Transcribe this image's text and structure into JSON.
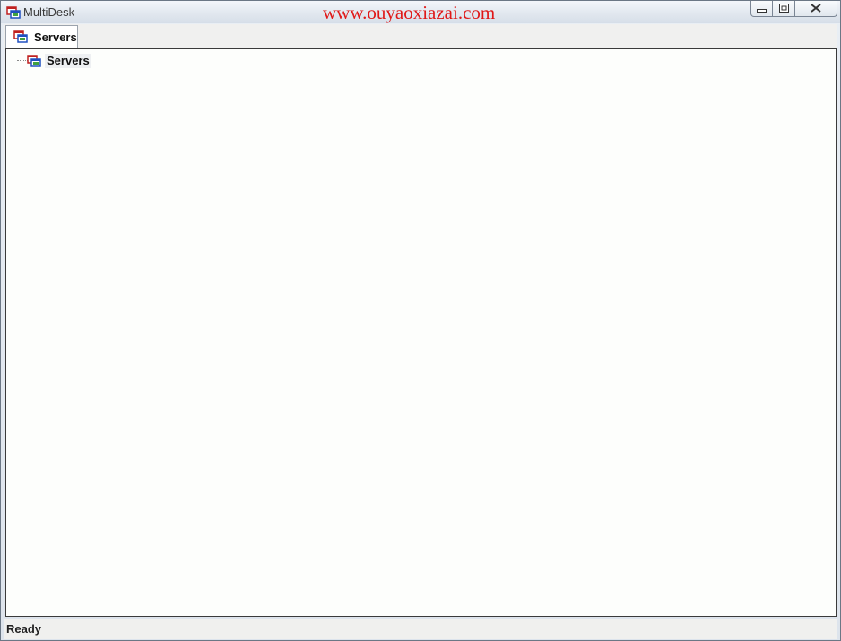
{
  "window": {
    "title": "MultiDesk",
    "watermark": "www.ouyaoxiazai.com"
  },
  "tabs": [
    {
      "label": "Servers",
      "icon": "servers-icon",
      "active": true
    }
  ],
  "tree": {
    "root": {
      "label": "Servers",
      "icon": "servers-icon"
    }
  },
  "status": {
    "text": "Ready"
  },
  "colors": {
    "watermark": "#e01818",
    "panel_background": "#fdfefc",
    "titlebar": "#e3e9f0"
  }
}
